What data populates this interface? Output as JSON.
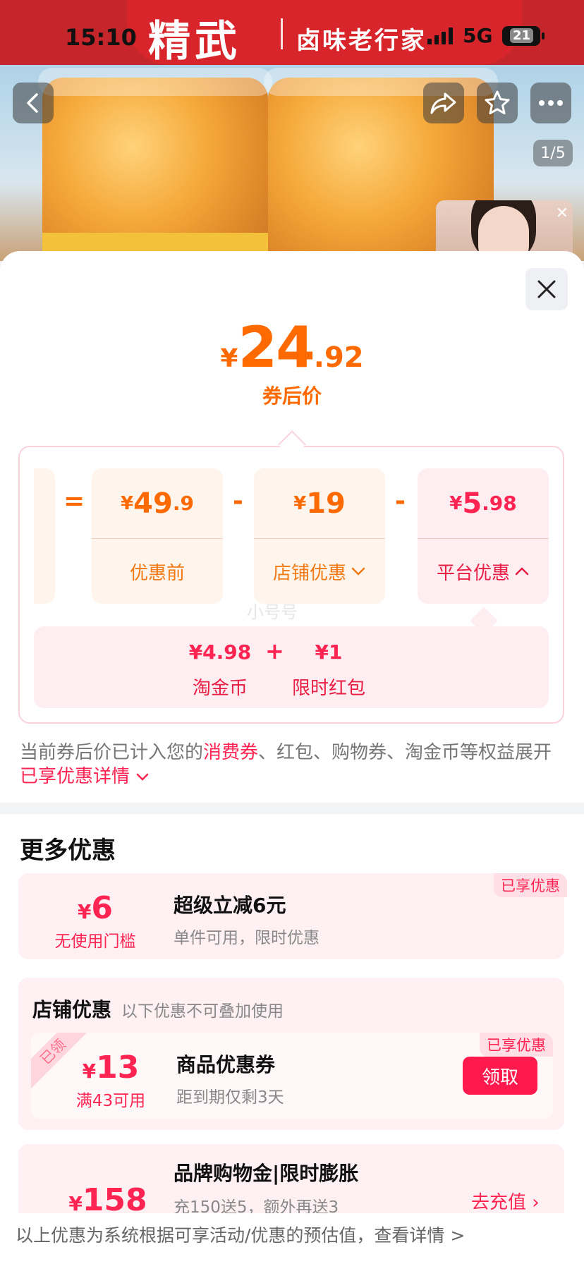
{
  "status_bar": {
    "time": "15:10",
    "network": "5G",
    "battery": "21"
  },
  "banner": {
    "brand": "精武",
    "subtitle": "卤味老行家",
    "page_indicator": "1/5"
  },
  "price": {
    "currency": "¥",
    "int": "24",
    "dec": ".92",
    "label": "券后价"
  },
  "breakdown": {
    "eq": "=",
    "minus": "-",
    "before": {
      "cur": "¥",
      "int": "49",
      "dec": ".9",
      "label": "优惠前"
    },
    "store": {
      "cur": "¥",
      "int": "19",
      "dec": "",
      "label": "店铺优惠"
    },
    "platform": {
      "cur": "¥",
      "int": "5",
      "dec": ".98",
      "label": "平台优惠"
    },
    "watermark": "小号号",
    "sub": [
      {
        "value": "¥4.98",
        "label": "淘金币"
      },
      {
        "value": "¥1",
        "label": "限时红包"
      }
    ],
    "plus": "+"
  },
  "note": {
    "p1": "当前券后价已计入您的",
    "hl1": "消费券",
    "p2": "、红包、购物券、淘金币等权益展开",
    "hl2": "已享优惠详情"
  },
  "more": {
    "title": "更多优惠",
    "promo1": {
      "tag": "已享优惠",
      "cur": "¥",
      "amount": "6",
      "cond": "无使用门槛",
      "title": "超级立减6元",
      "desc": "单件可用，限时优惠"
    },
    "shop": {
      "title": "店铺优惠",
      "subtitle": "以下优惠不可叠加使用",
      "ribbon": "已领",
      "tag": "已享优惠",
      "cur": "¥",
      "amount": "13",
      "cond": "满43可用",
      "item_title": "商品优惠券",
      "item_desc": "距到期仅剩3天",
      "button": "领取"
    },
    "promo3": {
      "cur": "¥",
      "amount": "158",
      "title": "品牌购物金|限时膨胀",
      "desc": "充150送5，额外再送3",
      "action": "去充值 ›"
    }
  },
  "footer": "以上优惠为系统根据可享活动/优惠的预估值，查看详情 >"
}
